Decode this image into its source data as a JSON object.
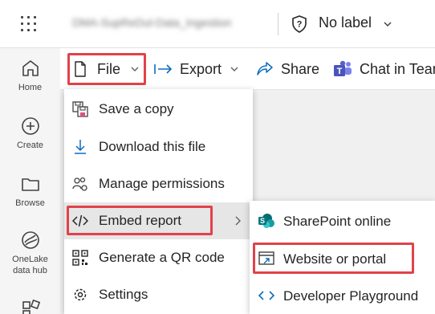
{
  "header": {
    "report_title": "DMA-SupReDul-Data_Ingestion",
    "sensitivity_label": "No label"
  },
  "nav": {
    "items": [
      {
        "label": "Home",
        "icon": "home-icon"
      },
      {
        "label": "Create",
        "icon": "create-icon"
      },
      {
        "label": "Browse",
        "icon": "browse-icon"
      },
      {
        "label": "OneLake data hub",
        "line1": "OneLake",
        "line2": "data hub",
        "icon": "onelake-icon"
      }
    ]
  },
  "toolbar": {
    "file": "File",
    "export": "Export",
    "share": "Share",
    "chat": "Chat in Teams"
  },
  "file_menu": {
    "items": [
      {
        "label": "Save a copy",
        "icon": "save-copy-icon"
      },
      {
        "label": "Download this file",
        "icon": "download-icon"
      },
      {
        "label": "Manage permissions",
        "icon": "permissions-icon"
      },
      {
        "label": "Embed report",
        "icon": "embed-icon"
      },
      {
        "label": "Generate a QR code",
        "icon": "qr-code-icon"
      },
      {
        "label": "Settings",
        "icon": "settings-icon"
      }
    ]
  },
  "embed_submenu": {
    "items": [
      {
        "label": "SharePoint online",
        "icon": "sharepoint-icon"
      },
      {
        "label": "Website or portal",
        "icon": "website-icon"
      },
      {
        "label": "Developer Playground",
        "icon": "developer-icon"
      }
    ]
  },
  "colors": {
    "highlight_outline": "#e0434a",
    "teams_purple": "#5b5fc7",
    "sharepoint_teal": "#038387",
    "onelake_blue": "#0f6cbd"
  }
}
